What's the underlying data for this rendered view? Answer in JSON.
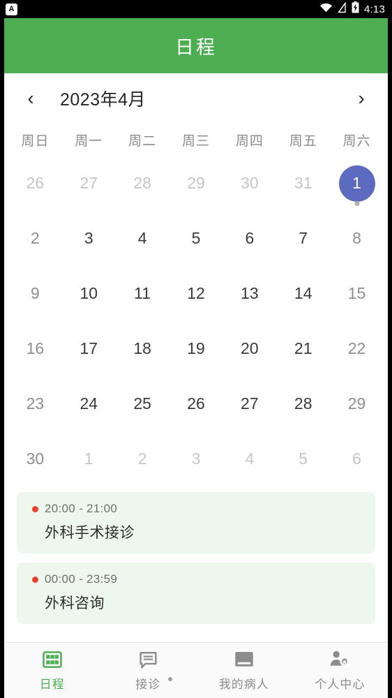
{
  "status_bar": {
    "app_icon_letter": "A",
    "wifi_icon": "wifi-icon",
    "signal_icon": "cell-signal-off-icon",
    "battery_icon": "battery-charging-icon",
    "time": "4:13"
  },
  "header": {
    "title": "日程",
    "background_color": "#4cae50"
  },
  "calendar": {
    "prev_label": "‹",
    "next_label": "›",
    "month_label": "2023年4月",
    "weekdays": [
      "周日",
      "周一",
      "周二",
      "周三",
      "周四",
      "周五",
      "周六"
    ],
    "selected_color": "#5c6bc0",
    "weeks": [
      [
        {
          "day": "26",
          "muted": true
        },
        {
          "day": "27",
          "muted": true
        },
        {
          "day": "28",
          "muted": true
        },
        {
          "day": "29",
          "muted": true
        },
        {
          "day": "30",
          "muted": true
        },
        {
          "day": "31",
          "muted": true
        },
        {
          "day": "1",
          "selected": true,
          "has_event": true
        }
      ],
      [
        {
          "day": "2",
          "weekend": true
        },
        {
          "day": "3"
        },
        {
          "day": "4"
        },
        {
          "day": "5"
        },
        {
          "day": "6"
        },
        {
          "day": "7"
        },
        {
          "day": "8",
          "weekend": true
        }
      ],
      [
        {
          "day": "9",
          "weekend": true
        },
        {
          "day": "10"
        },
        {
          "day": "11"
        },
        {
          "day": "12"
        },
        {
          "day": "13"
        },
        {
          "day": "14"
        },
        {
          "day": "15",
          "weekend": true
        }
      ],
      [
        {
          "day": "16",
          "weekend": true
        },
        {
          "day": "17"
        },
        {
          "day": "18"
        },
        {
          "day": "19"
        },
        {
          "day": "20"
        },
        {
          "day": "21"
        },
        {
          "day": "22",
          "weekend": true
        }
      ],
      [
        {
          "day": "23",
          "weekend": true
        },
        {
          "day": "24"
        },
        {
          "day": "25"
        },
        {
          "day": "26"
        },
        {
          "day": "27"
        },
        {
          "day": "28"
        },
        {
          "day": "29",
          "weekend": true
        }
      ],
      [
        {
          "day": "30",
          "weekend": true
        },
        {
          "day": "1",
          "muted": true
        },
        {
          "day": "2",
          "muted": true
        },
        {
          "day": "3",
          "muted": true
        },
        {
          "day": "4",
          "muted": true
        },
        {
          "day": "5",
          "muted": true
        },
        {
          "day": "6",
          "muted": true
        }
      ]
    ]
  },
  "events": {
    "dot_color": "#e8402e",
    "card_color": "#eef7ed",
    "items": [
      {
        "time": "20:00 - 21:00",
        "title": "外科手术接诊"
      },
      {
        "time": "00:00 - 23:59",
        "title": "外科咨询"
      }
    ]
  },
  "bottom_nav": {
    "active_color": "#4cae50",
    "items": [
      {
        "label": "日程",
        "icon": "calendar-grid-icon",
        "active": true
      },
      {
        "label": "接诊",
        "icon": "chat-bubble-icon",
        "badge": true
      },
      {
        "label": "我的病人",
        "icon": "patient-book-icon"
      },
      {
        "label": "个人中心",
        "icon": "person-gear-icon"
      }
    ]
  }
}
